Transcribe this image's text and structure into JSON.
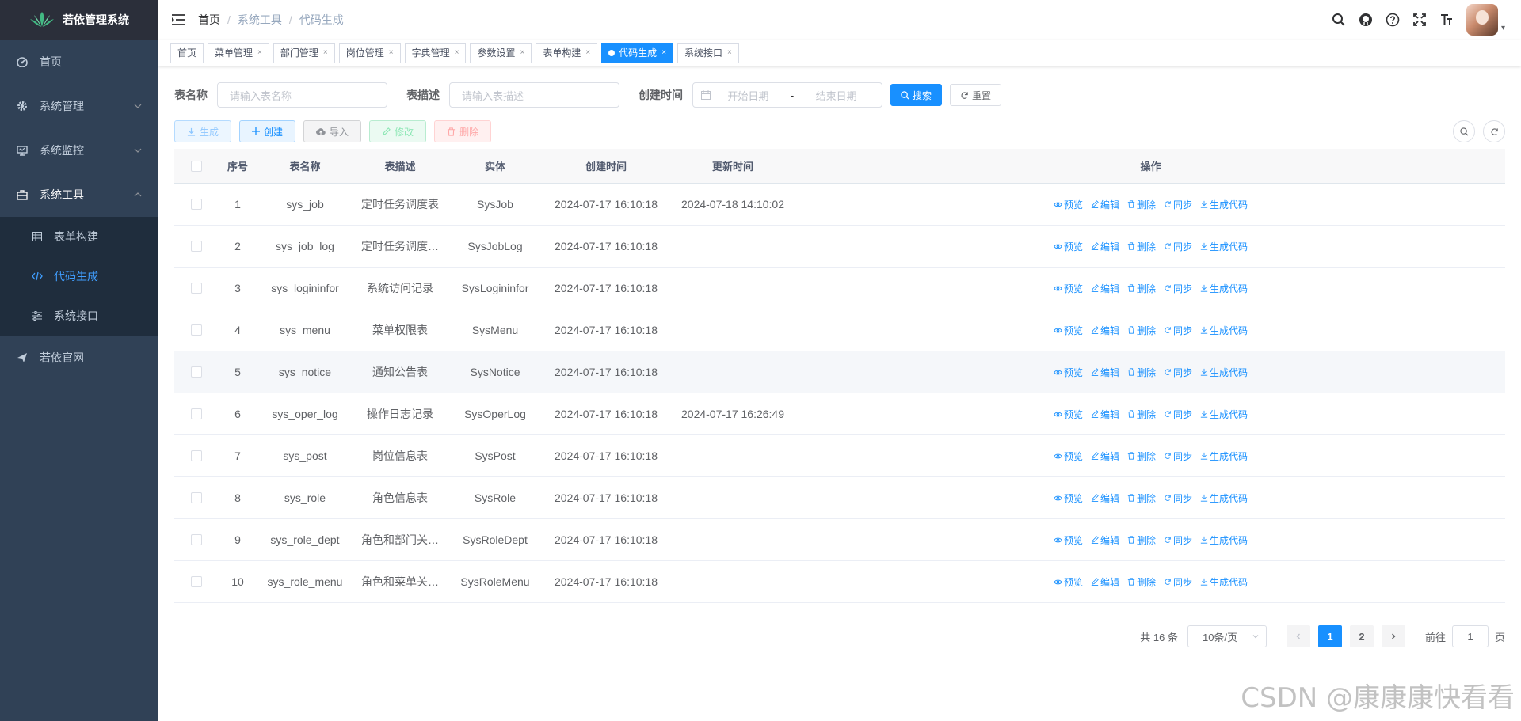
{
  "sidebar": {
    "logo_text": "若依管理系统",
    "items": [
      {
        "label": "首页"
      },
      {
        "label": "系统管理"
      },
      {
        "label": "系统监控"
      },
      {
        "label": "系统工具"
      }
    ],
    "sub_items": [
      {
        "label": "表单构建"
      },
      {
        "label": "代码生成"
      },
      {
        "label": "系统接口"
      }
    ],
    "external": {
      "label": "若依官网"
    }
  },
  "breadcrumb": [
    "首页",
    "系统工具",
    "代码生成"
  ],
  "tags": [
    {
      "label": "首页"
    },
    {
      "label": "菜单管理"
    },
    {
      "label": "部门管理"
    },
    {
      "label": "岗位管理"
    },
    {
      "label": "字典管理"
    },
    {
      "label": "参数设置"
    },
    {
      "label": "表单构建"
    },
    {
      "label": "代码生成"
    },
    {
      "label": "系统接口"
    }
  ],
  "search": {
    "table_name_label": "表名称",
    "table_name_placeholder": "请输入表名称",
    "table_desc_label": "表描述",
    "table_desc_placeholder": "请输入表描述",
    "create_time_label": "创建时间",
    "start_placeholder": "开始日期",
    "range_sep": "-",
    "end_placeholder": "结束日期",
    "search_btn": "搜索",
    "reset_btn": "重置"
  },
  "toolbar": {
    "generate": "生成",
    "create": "创建",
    "import": "导入",
    "edit": "修改",
    "delete": "删除"
  },
  "table": {
    "headers": {
      "index": "序号",
      "name": "表名称",
      "desc": "表描述",
      "entity": "实体",
      "create": "创建时间",
      "update": "更新时间",
      "ops": "操作"
    },
    "ops": {
      "preview": "预览",
      "edit": "编辑",
      "delete": "删除",
      "sync": "同步",
      "gen": "生成代码"
    },
    "rows": [
      {
        "index": "1",
        "name": "sys_job",
        "desc": "定时任务调度表",
        "entity": "SysJob",
        "create": "2024-07-17 16:10:18",
        "update": "2024-07-18 14:10:02"
      },
      {
        "index": "2",
        "name": "sys_job_log",
        "desc": "定时任务调度…",
        "entity": "SysJobLog",
        "create": "2024-07-17 16:10:18",
        "update": ""
      },
      {
        "index": "3",
        "name": "sys_logininfor",
        "desc": "系统访问记录",
        "entity": "SysLogininfor",
        "create": "2024-07-17 16:10:18",
        "update": ""
      },
      {
        "index": "4",
        "name": "sys_menu",
        "desc": "菜单权限表",
        "entity": "SysMenu",
        "create": "2024-07-17 16:10:18",
        "update": ""
      },
      {
        "index": "5",
        "name": "sys_notice",
        "desc": "通知公告表",
        "entity": "SysNotice",
        "create": "2024-07-17 16:10:18",
        "update": ""
      },
      {
        "index": "6",
        "name": "sys_oper_log",
        "desc": "操作日志记录",
        "entity": "SysOperLog",
        "create": "2024-07-17 16:10:18",
        "update": "2024-07-17 16:26:49"
      },
      {
        "index": "7",
        "name": "sys_post",
        "desc": "岗位信息表",
        "entity": "SysPost",
        "create": "2024-07-17 16:10:18",
        "update": ""
      },
      {
        "index": "8",
        "name": "sys_role",
        "desc": "角色信息表",
        "entity": "SysRole",
        "create": "2024-07-17 16:10:18",
        "update": ""
      },
      {
        "index": "9",
        "name": "sys_role_dept",
        "desc": "角色和部门关…",
        "entity": "SysRoleDept",
        "create": "2024-07-17 16:10:18",
        "update": ""
      },
      {
        "index": "10",
        "name": "sys_role_menu",
        "desc": "角色和菜单关…",
        "entity": "SysRoleMenu",
        "create": "2024-07-17 16:10:18",
        "update": ""
      }
    ]
  },
  "pagination": {
    "total": "共 16 条",
    "page_size": "10条/页",
    "pages": [
      "1",
      "2"
    ],
    "jump_prefix": "前往",
    "jump_value": "1",
    "jump_suffix": "页"
  },
  "watermark": "CSDN @康康康快看看",
  "colors": {
    "primary": "#1890ff",
    "sidebar": "#304156",
    "submenu": "#1f2d3d"
  }
}
